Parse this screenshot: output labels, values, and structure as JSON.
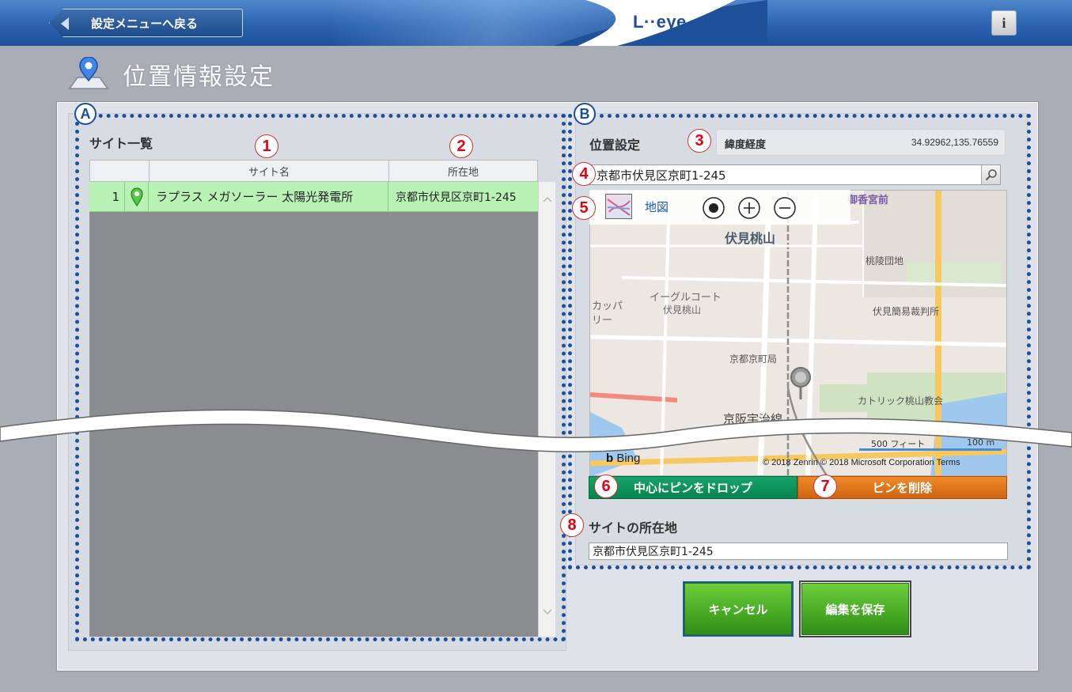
{
  "header": {
    "back_label": "設定メニューへ戻る",
    "logo": "L··eye",
    "info_icon": "info-icon",
    "info_glyph": "i"
  },
  "page": {
    "title": "位置情報設定",
    "title_icon": "location-pin-icon"
  },
  "callouts": {
    "A": "A",
    "B": "B",
    "n1": "1",
    "n2": "2",
    "n3": "3",
    "n4": "4",
    "n5": "5",
    "n6": "6",
    "n7": "7",
    "n8": "8"
  },
  "site_list": {
    "title": "サイト一覧",
    "columns": [
      "サイト名",
      "所在地"
    ],
    "rows": [
      {
        "index": "1",
        "icon": "map-pin-icon",
        "name": "ラプラス メガソーラー 太陽光発電所",
        "address": "京都市伏見区京町1-245",
        "selected": true
      }
    ]
  },
  "location": {
    "title": "位置設定",
    "latlng_label": "緯度経度",
    "latlng_value": "34.92962,135.76559",
    "search_value": "京都市伏見区京町1-245",
    "map_type_label": "地図",
    "map_labels": {
      "fushimi_momoyama": "伏見桃山",
      "goko_jingu": "御香宮前",
      "momoyama_danchi": "桃陵団地",
      "eagle_court_1": "イーグルコート",
      "eagle_court_2": "伏見桃山",
      "kappa_1": "カッパ",
      "kappa_2": "リー",
      "court": "伏見簡易裁判所",
      "post_office": "京都京町局",
      "church": "カトリック桃山教会",
      "keihan": "京阪宇治線",
      "scale_ft": "500 フィート",
      "scale_m": "100 m",
      "bing": "Bing",
      "copyright": "© 2018 Zenrin © 2018 Microsoft Corporation  Terms"
    },
    "drop_pin_label": "中心にピンをドロップ",
    "delete_pin_label": "ピンを削除",
    "address_label": "サイトの所在地",
    "address_value": "京都市伏見区京町1-245"
  },
  "actions": {
    "cancel_label": "キャンセル",
    "save_label": "編集を保存"
  },
  "colors": {
    "accent_blue": "#1a4fa0",
    "callout_red": "#e60012",
    "selected_row": "#b8f2b5",
    "drop_button": "#0f9a60",
    "delete_button": "#e07a20",
    "save_green": "#4caf2a"
  }
}
